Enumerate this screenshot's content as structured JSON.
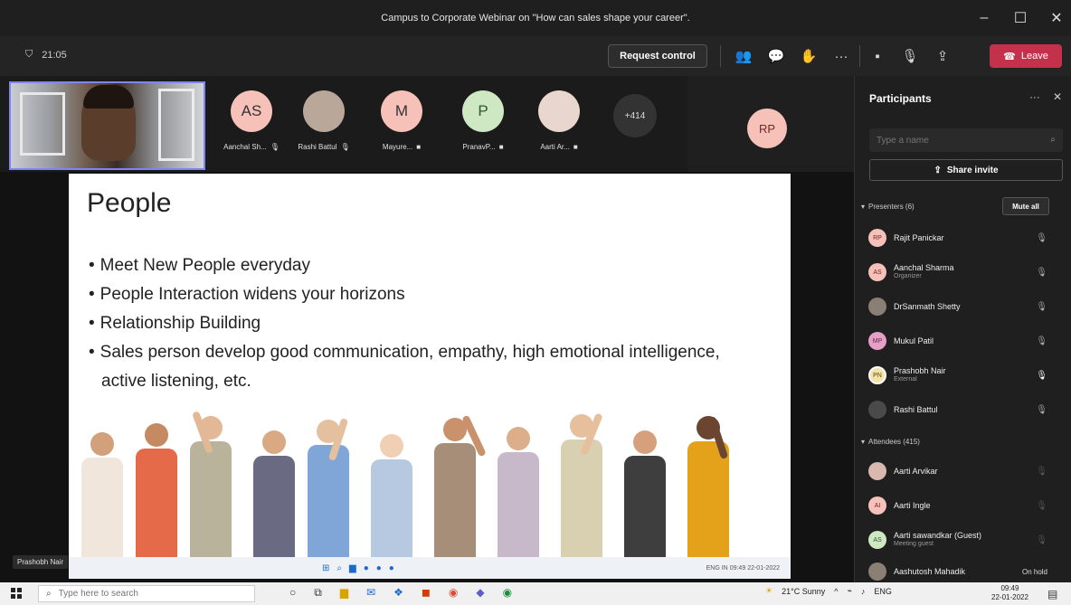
{
  "window": {
    "title": "Campus to Corporate Webinar on \"How can sales shape your career\".",
    "minimize": "–",
    "maximize": "☐",
    "close": "✕"
  },
  "toolbar": {
    "timer": "21:05",
    "request_control": "Request control",
    "more": "···",
    "leave": "Leave",
    "icons": [
      "participants-icon",
      "chat-icon",
      "reactions-icon",
      "more-icon",
      "camera-off-icon",
      "mic-off-icon",
      "share-icon"
    ]
  },
  "tiles": [
    {
      "initials": "AS",
      "name": "Aanchal Sh...",
      "bg": "#f6c1b8",
      "photo": false
    },
    {
      "initials": "",
      "name": "Rashi Battul",
      "bg": "#b9a89a",
      "photo": true
    },
    {
      "initials": "M",
      "name": "Mayure...",
      "bg": "#f6c1b8",
      "photo": false
    },
    {
      "initials": "P",
      "name": "PranavP...",
      "bg": "#cfe8c4",
      "photo": false
    },
    {
      "initials": "",
      "name": "Aarti Ar...",
      "bg": "#e9d6cf",
      "photo": true
    }
  ],
  "more_count": "+414",
  "spotlight": {
    "initials": "RP"
  },
  "slide": {
    "title": "People",
    "bullets": [
      "Meet New People everyday",
      "People Interaction widens your horizons",
      "Relationship Building",
      "Sales person develop good communication, empathy, high emotional intelligence, active listening, etc."
    ]
  },
  "presenter_label": "Prashobh Nair",
  "shared_taskbar": {
    "lang": "ENG IN",
    "time": "09:49",
    "date": "22-01-2022"
  },
  "panel": {
    "title": "Participants",
    "more": "···",
    "close": "✕",
    "search_placeholder": "Type a name",
    "share_invite": "Share invite",
    "presenters_header": "Presenters (6)",
    "mute_all": "Mute all",
    "presenters": [
      {
        "initials": "RP",
        "name": "Rajit Panickar",
        "sub": ""
      },
      {
        "initials": "AS",
        "name": "Aanchal Sharma",
        "sub": "Organizer"
      },
      {
        "initials": "",
        "name": "DrSanmath Shetty",
        "sub": ""
      },
      {
        "initials": "MP",
        "name": "Mukul Patil",
        "sub": ""
      },
      {
        "initials": "PN",
        "name": "Prashobh Nair",
        "sub": "External"
      },
      {
        "initials": "",
        "name": "Rashi Battul",
        "sub": ""
      }
    ],
    "attendees_header": "Attendees (415)",
    "attendees": [
      {
        "initials": "",
        "name": "Aarti Arvikar",
        "sub": ""
      },
      {
        "initials": "AI",
        "name": "Aarti Ingle",
        "sub": ""
      },
      {
        "initials": "AS",
        "name": "Aarti sawandkar (Guest)",
        "sub": "Meeting guest"
      },
      {
        "initials": "",
        "name": "Aashutosh Mahadik",
        "sub": "",
        "status": "On hold"
      }
    ]
  },
  "taskbar": {
    "search_placeholder": "Type here to search",
    "weather": "21°C Sunny",
    "lang": "ENG",
    "time": "09:49",
    "date": "22-01-2022"
  },
  "colors": {
    "leave": "#c4314b",
    "accent": "#7f85f5"
  }
}
